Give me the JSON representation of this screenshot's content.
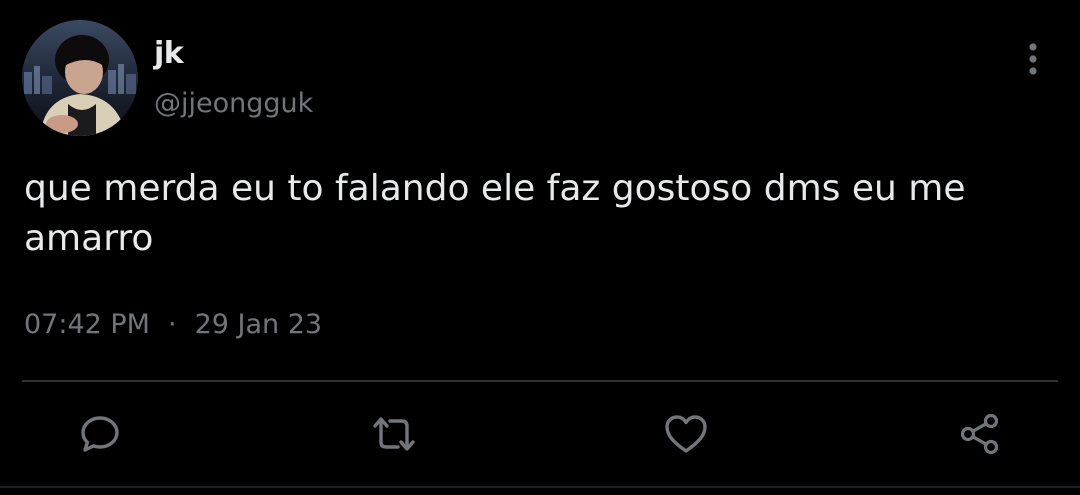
{
  "tweet": {
    "author": {
      "display_name": "jk",
      "handle": "@jjeongguk",
      "avatar_icon": "profile-photo"
    },
    "text": "que merda eu to falando ele faz gostoso dms eu me\namarro",
    "time": "07:42 PM",
    "separator": "·",
    "date": "29 Jan 23"
  },
  "actions": {
    "reply_icon": "speech-bubble-icon",
    "retweet_icon": "retweet-icon",
    "like_icon": "heart-icon",
    "share_icon": "share-icon",
    "more_icon": "vertical-dots-icon"
  },
  "colors": {
    "background": "#000000",
    "primary_text": "#e7e9ea",
    "secondary_text": "#71767b",
    "divider": "#2f3336"
  }
}
